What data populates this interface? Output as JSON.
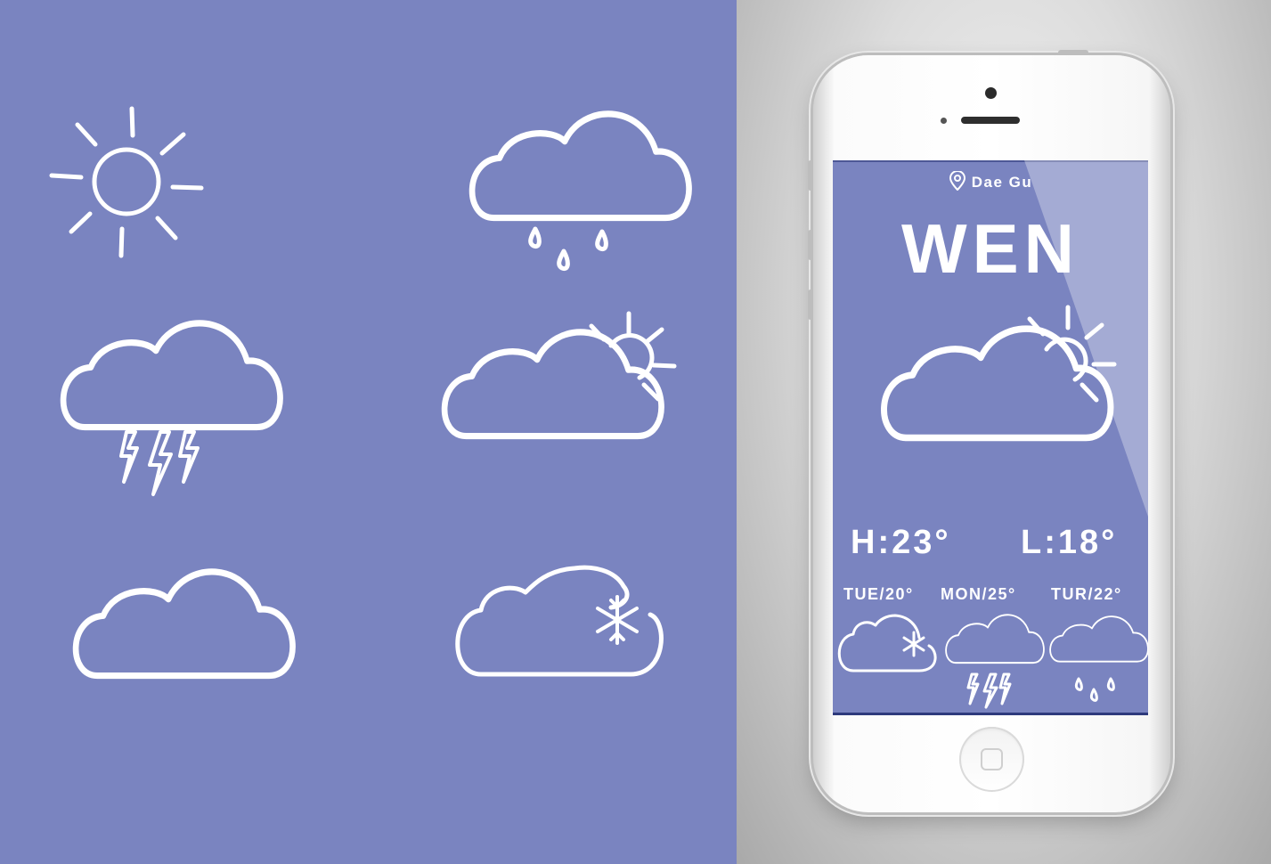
{
  "colors": {
    "accent": "#7a84c0",
    "icon_stroke": "#ffffff"
  },
  "icon_set": [
    "sun-icon",
    "cloud-rain-icon",
    "cloud-thunder-icon",
    "cloud-sun-icon",
    "cloud-icon",
    "cloud-snow-icon"
  ],
  "weather_app": {
    "location": "Dae Gu",
    "location_icon": "map-pin-icon",
    "day": "WEN",
    "current_icon": "cloud-sun-icon",
    "high": "H:23°",
    "low": "L:18°",
    "forecast": [
      {
        "label": "TUE/20°",
        "icon": "cloud-snow-icon"
      },
      {
        "label": "MON/25°",
        "icon": "cloud-thunder-icon"
      },
      {
        "label": "TUR/22°",
        "icon": "cloud-rain-icon"
      }
    ]
  }
}
